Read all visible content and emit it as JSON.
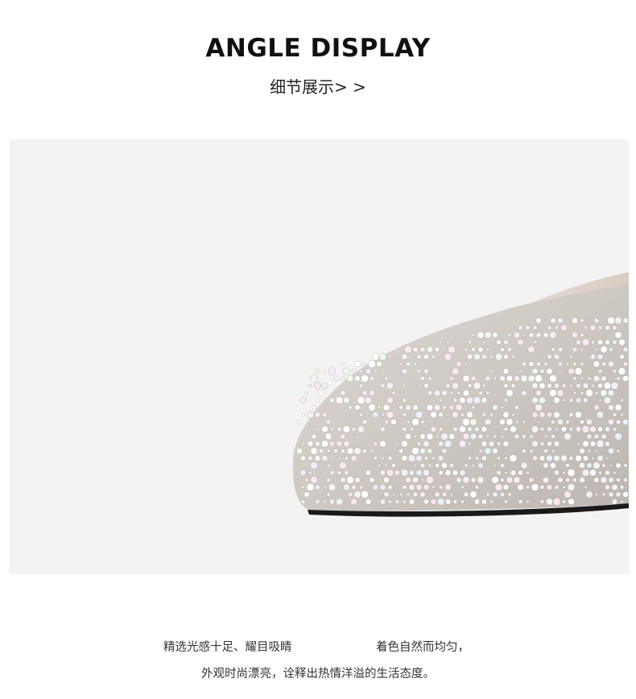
{
  "header": {
    "title": "ANGLE DISPLAY",
    "subtitle": "细节展示> >"
  },
  "photo": {
    "subject": "shoe-detail-photo",
    "background_color": "#f3f3f3"
  },
  "caption": {
    "line1_part1": "精选光感十足、耀目吸睛",
    "line1_part2": "着色自然而均匀，",
    "line2": "外观时尚漂亮，诠释出热情洋溢的生活态度。"
  }
}
